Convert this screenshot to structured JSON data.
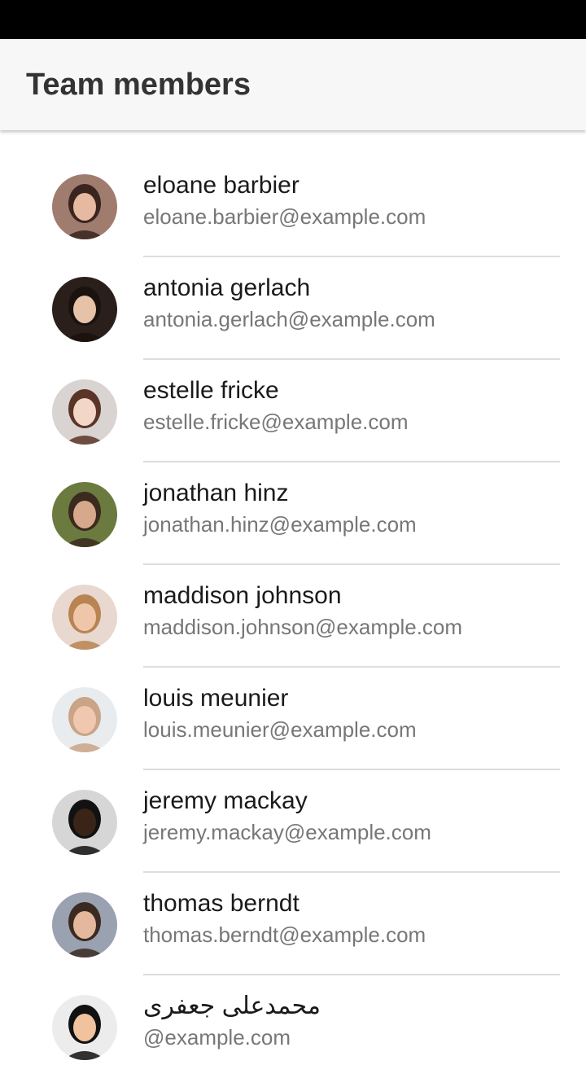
{
  "app_bar": {
    "title": "Team members"
  },
  "members": [
    {
      "name": "eloane barbier",
      "email": "eloane.barbier@example.com",
      "avatar_bg": "#a07c6e",
      "avatar_skin": "#e7b9a0",
      "avatar_hair": "#3a2420"
    },
    {
      "name": "antonia gerlach",
      "email": "antonia.gerlach@example.com",
      "avatar_bg": "#2a1f1a",
      "avatar_skin": "#e6c2a8",
      "avatar_hair": "#1a120e"
    },
    {
      "name": "estelle fricke",
      "email": "estelle.fricke@example.com",
      "avatar_bg": "#d9d4d2",
      "avatar_skin": "#f2d6c8",
      "avatar_hair": "#5a3527"
    },
    {
      "name": "jonathan hinz",
      "email": "jonathan.hinz@example.com",
      "avatar_bg": "#6b7a3e",
      "avatar_skin": "#d8a88c",
      "avatar_hair": "#3b2a1e"
    },
    {
      "name": "maddison johnson",
      "email": "maddison.johnson@example.com",
      "avatar_bg": "#e8d8cf",
      "avatar_skin": "#f0c6ab",
      "avatar_hair": "#b88452"
    },
    {
      "name": "louis meunier",
      "email": "louis.meunier@example.com",
      "avatar_bg": "#e8ecef",
      "avatar_skin": "#f0c8b0",
      "avatar_hair": "#c9a486"
    },
    {
      "name": "jeremy mackay",
      "email": "jeremy.mackay@example.com",
      "avatar_bg": "#d6d6d6",
      "avatar_skin": "#3a2418",
      "avatar_hair": "#111111"
    },
    {
      "name": "thomas berndt",
      "email": "thomas.berndt@example.com",
      "avatar_bg": "#9aa1b0",
      "avatar_skin": "#e3b89c",
      "avatar_hair": "#3a2a22"
    },
    {
      "name": "محمدعلی جعفری",
      "email": "@example.com",
      "avatar_bg": "#ececec",
      "avatar_skin": "#f0c29e",
      "avatar_hair": "#111111"
    }
  ]
}
